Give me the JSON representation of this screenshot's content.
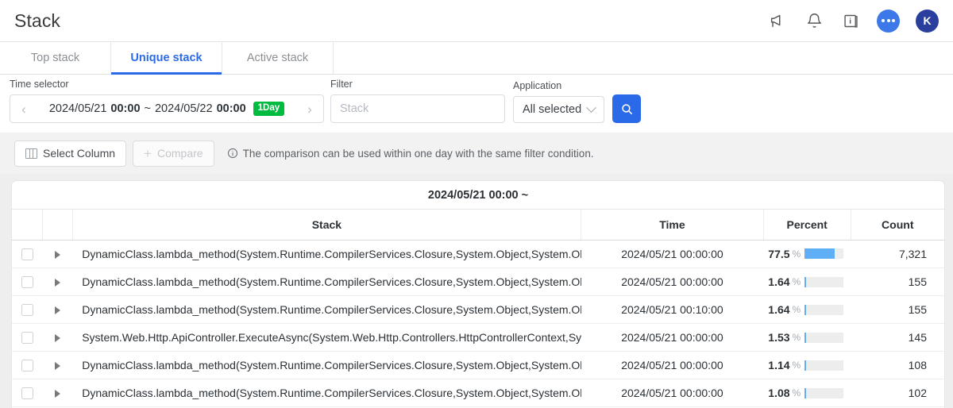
{
  "header": {
    "title": "Stack",
    "icons": [
      {
        "name": "megaphone-icon"
      },
      {
        "name": "bell-icon"
      },
      {
        "name": "info-book-icon"
      },
      {
        "name": "chat-icon"
      }
    ],
    "avatar_initial": "K",
    "avatar_color": "#2a3f9d",
    "chat_color": "#3d78e8"
  },
  "tabs": [
    {
      "label": "Top stack",
      "active": false
    },
    {
      "label": "Unique stack",
      "active": true
    },
    {
      "label": "Active stack",
      "active": false
    }
  ],
  "filters": {
    "time_label": "Time selector",
    "time_start_date": "2024/05/21",
    "time_start_time": "00:00",
    "time_separator": "~",
    "time_end_date": "2024/05/22",
    "time_end_time": "00:00",
    "time_badge": "1Day",
    "prev_arrow": "‹",
    "next_arrow": "›",
    "filter_label": "Filter",
    "filter_value": "",
    "filter_placeholder": "Stack",
    "application_label": "Application",
    "application_value": "All selected",
    "search_icon": "search-icon",
    "accent_color": "#2a6ae8",
    "badge_color": "#00bb3f"
  },
  "toolbar": {
    "select_column_label": "Select Column",
    "compare_label": "Compare",
    "compare_plus": "+",
    "hint_text": "The comparison can be used within one day with the same filter condition.",
    "info_icon": "info-circle-icon"
  },
  "table": {
    "title": "2024/05/21 00:00 ~",
    "columns": [
      {
        "key": "check",
        "label": ""
      },
      {
        "key": "expand",
        "label": ""
      },
      {
        "key": "stack",
        "label": "Stack"
      },
      {
        "key": "time",
        "label": "Time"
      },
      {
        "key": "percent",
        "label": "Percent"
      },
      {
        "key": "count",
        "label": "Count"
      }
    ],
    "rows": [
      {
        "stack": "DynamicClass.lambda_method(System.Runtime.CompilerServices.Closure,System.Object,System.Obj",
        "time": "2024/05/21 00:00:00",
        "percent": "77.5",
        "percent_sign": "%",
        "bar_pct": 77.5,
        "count": "7,321"
      },
      {
        "stack": "DynamicClass.lambda_method(System.Runtime.CompilerServices.Closure,System.Object,System.Obj",
        "time": "2024/05/21 00:00:00",
        "percent": "1.64",
        "percent_sign": "%",
        "bar_pct": 1.64,
        "count": "155"
      },
      {
        "stack": "DynamicClass.lambda_method(System.Runtime.CompilerServices.Closure,System.Object,System.Obj",
        "time": "2024/05/21 00:10:00",
        "percent": "1.64",
        "percent_sign": "%",
        "bar_pct": 1.64,
        "count": "155"
      },
      {
        "stack": "System.Web.Http.ApiController.ExecuteAsync(System.Web.Http.Controllers.HttpControllerContext,Sys",
        "time": "2024/05/21 00:00:00",
        "percent": "1.53",
        "percent_sign": "%",
        "bar_pct": 1.53,
        "count": "145"
      },
      {
        "stack": "DynamicClass.lambda_method(System.Runtime.CompilerServices.Closure,System.Object,System.Obj",
        "time": "2024/05/21 00:00:00",
        "percent": "1.14",
        "percent_sign": "%",
        "bar_pct": 1.14,
        "count": "108"
      },
      {
        "stack": "DynamicClass.lambda_method(System.Runtime.CompilerServices.Closure,System.Object,System.Obj",
        "time": "2024/05/21 00:00:00",
        "percent": "1.08",
        "percent_sign": "%",
        "bar_pct": 1.08,
        "count": "102"
      }
    ]
  }
}
